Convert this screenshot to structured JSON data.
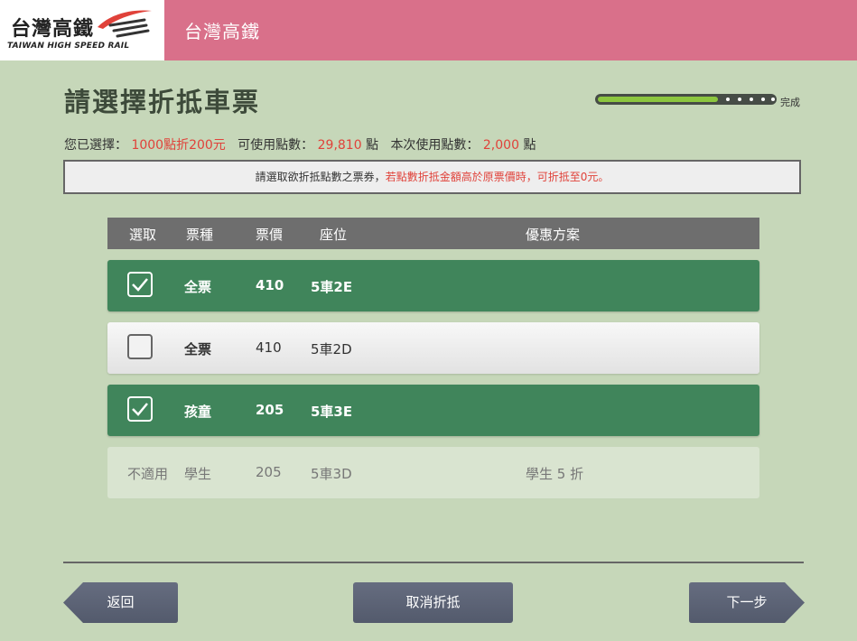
{
  "header": {
    "logo_zh": "台灣高鐵",
    "logo_en": "TAIWAN HIGH SPEED RAIL",
    "title": "台灣高鐵"
  },
  "page_title": "請選擇折抵車票",
  "progress": {
    "fraction": 0.68,
    "label": "完成"
  },
  "summary": {
    "selected_label": "您已選擇：",
    "selected_value": "1000點折200元",
    "available_label": "可使用點數：",
    "available_value": "29,810",
    "available_unit": "點",
    "using_label": "本次使用點數：",
    "using_value": "2,000",
    "using_unit": "點"
  },
  "notice": {
    "text": "請選取欲折抵點數之票券，",
    "warning": "若點數折抵金額高於原票價時，可折抵至0元。"
  },
  "table": {
    "headers": [
      "選取",
      "票種",
      "票價",
      "座位",
      "優惠方案"
    ],
    "rows": [
      {
        "status": "checked",
        "type": "全票",
        "price": "410",
        "seat": "5車2E",
        "discount": ""
      },
      {
        "status": "unchecked",
        "type": "全票",
        "price": "410",
        "seat": "5車2D",
        "discount": ""
      },
      {
        "status": "checked",
        "type": "孩童",
        "price": "205",
        "seat": "5車3E",
        "discount": ""
      },
      {
        "status": "不適用",
        "type": "學生",
        "price": "205",
        "seat": "5車3D",
        "discount": "學生 5 折"
      }
    ]
  },
  "buttons": {
    "back": "返回",
    "cancel": "取消折抵",
    "next": "下一步"
  },
  "colors": {
    "header_pink": "#d9708a",
    "background": "#c6d7b9",
    "selected_row": "#40855b",
    "accent_red": "#e0423a",
    "progress_green": "#8cc63f",
    "button": "#5c6375"
  }
}
